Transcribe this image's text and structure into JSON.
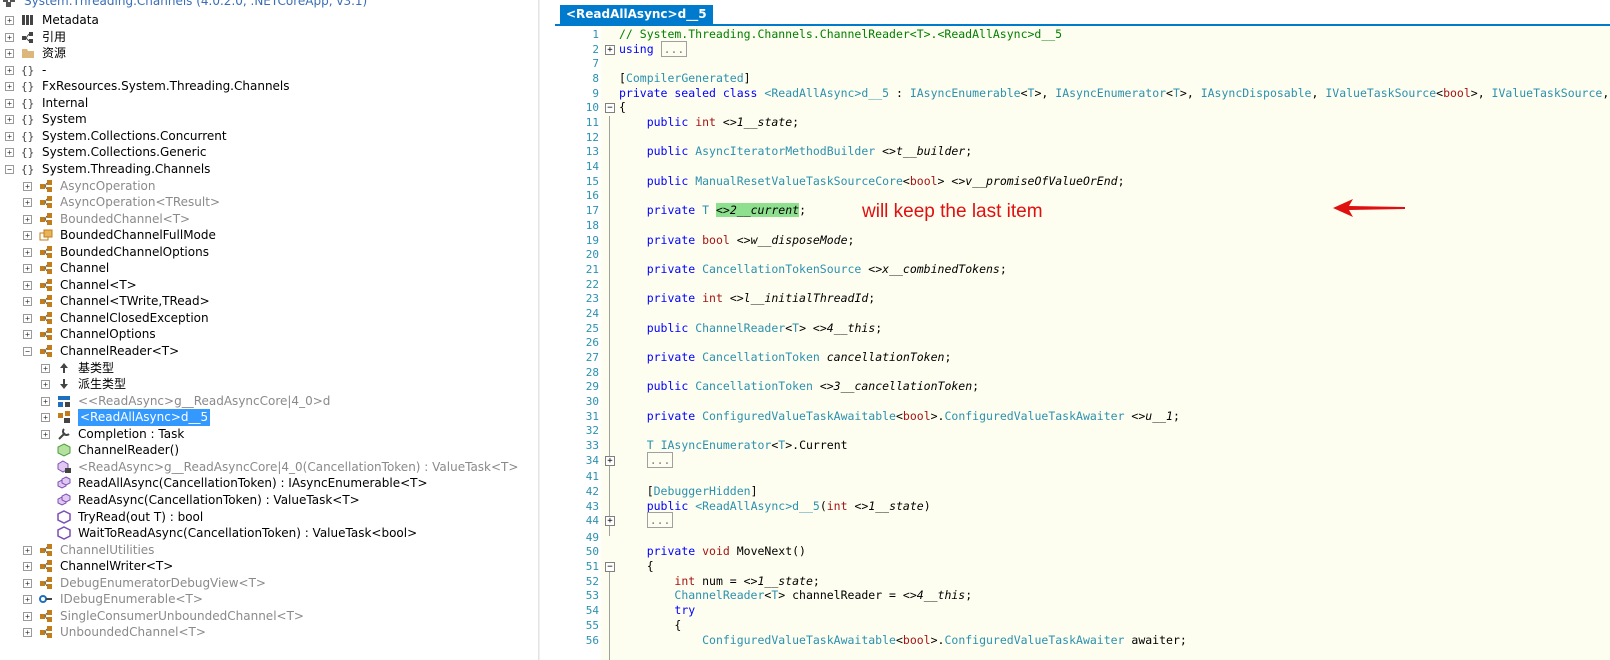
{
  "tree": {
    "root": "System.Threading.Channels (4.0.2.0, .NETCoreApp, v3.1)",
    "items": [
      {
        "label": "Metadata",
        "icon": "metadata-icon",
        "expander": "+",
        "indent": 0,
        "color": "black"
      },
      {
        "label": "引用",
        "icon": "references-icon",
        "expander": "+",
        "indent": 0,
        "color": "black"
      },
      {
        "label": "资源",
        "icon": "folder-icon",
        "expander": "+",
        "indent": 0,
        "color": "black"
      },
      {
        "label": "-",
        "icon": "namespace-icon",
        "expander": "+",
        "indent": 0,
        "color": "black"
      },
      {
        "label": "FxResources.System.Threading.Channels",
        "icon": "namespace-icon",
        "expander": "+",
        "indent": 0,
        "color": "black"
      },
      {
        "label": "Internal",
        "icon": "namespace-icon",
        "expander": "+",
        "indent": 0,
        "color": "black"
      },
      {
        "label": "System",
        "icon": "namespace-icon",
        "expander": "+",
        "indent": 0,
        "color": "black"
      },
      {
        "label": "System.Collections.Concurrent",
        "icon": "namespace-icon",
        "expander": "+",
        "indent": 0,
        "color": "black"
      },
      {
        "label": "System.Collections.Generic",
        "icon": "namespace-icon",
        "expander": "+",
        "indent": 0,
        "color": "black"
      },
      {
        "label": "System.Threading.Channels",
        "icon": "namespace-icon",
        "expander": "−",
        "indent": 0,
        "color": "black"
      },
      {
        "label": "AsyncOperation",
        "icon": "class-icon",
        "expander": "+",
        "indent": 1,
        "color": "gray"
      },
      {
        "label": "AsyncOperation<TResult>",
        "icon": "class-icon",
        "expander": "+",
        "indent": 1,
        "color": "gray"
      },
      {
        "label": "BoundedChannel<T>",
        "icon": "class-icon",
        "expander": "+",
        "indent": 1,
        "color": "gray"
      },
      {
        "label": "BoundedChannelFullMode",
        "icon": "enum-icon",
        "expander": "+",
        "indent": 1,
        "color": "black"
      },
      {
        "label": "BoundedChannelOptions",
        "icon": "class-icon",
        "expander": "+",
        "indent": 1,
        "color": "black"
      },
      {
        "label": "Channel",
        "icon": "class-icon",
        "expander": "+",
        "indent": 1,
        "color": "black"
      },
      {
        "label": "Channel<T>",
        "icon": "class-icon",
        "expander": "+",
        "indent": 1,
        "color": "black"
      },
      {
        "label": "Channel<TWrite,TRead>",
        "icon": "class-icon",
        "expander": "+",
        "indent": 1,
        "color": "black"
      },
      {
        "label": "ChannelClosedException",
        "icon": "class-icon",
        "expander": "+",
        "indent": 1,
        "color": "black"
      },
      {
        "label": "ChannelOptions",
        "icon": "class-icon",
        "expander": "+",
        "indent": 1,
        "color": "black"
      },
      {
        "label": "ChannelReader<T>",
        "icon": "class-icon",
        "expander": "−",
        "indent": 1,
        "color": "black"
      },
      {
        "label": "基类型",
        "icon": "base-types-icon",
        "expander": "+",
        "indent": 2,
        "color": "black"
      },
      {
        "label": "派生类型",
        "icon": "derived-types-icon",
        "expander": "+",
        "indent": 2,
        "color": "black"
      },
      {
        "label": "<<ReadAsync>g__ReadAsyncCore|4_0>d",
        "icon": "struct-icon",
        "expander": "+",
        "indent": 2,
        "color": "gray"
      },
      {
        "label": "<ReadAllAsync>d__5",
        "icon": "private-class-icon",
        "expander": "+",
        "indent": 2,
        "color": "black",
        "selected": true
      },
      {
        "label": "Completion : Task",
        "icon": "property-icon",
        "expander": "+",
        "indent": 2,
        "color": "black"
      },
      {
        "label": "ChannelReader()",
        "icon": "method-icon",
        "expander": "",
        "indent": 2,
        "color": "black"
      },
      {
        "label": "<ReadAsync>g__ReadAsyncCore|4_0(CancellationToken) : ValueTask<T>",
        "icon": "private-method-icon",
        "expander": "",
        "indent": 2,
        "color": "gray"
      },
      {
        "label": "ReadAllAsync(CancellationToken) : IAsyncEnumerable<T>",
        "icon": "virtual-method-icon",
        "expander": "",
        "indent": 2,
        "color": "black"
      },
      {
        "label": "ReadAsync(CancellationToken) : ValueTask<T>",
        "icon": "virtual-method-icon",
        "expander": "",
        "indent": 2,
        "color": "black"
      },
      {
        "label": "TryRead(out T) : bool",
        "icon": "abstract-method-icon",
        "expander": "",
        "indent": 2,
        "color": "black"
      },
      {
        "label": "WaitToReadAsync(CancellationToken) : ValueTask<bool>",
        "icon": "abstract-method-icon",
        "expander": "",
        "indent": 2,
        "color": "black"
      },
      {
        "label": "ChannelUtilities",
        "icon": "class-icon",
        "expander": "+",
        "indent": 1,
        "color": "gray"
      },
      {
        "label": "ChannelWriter<T>",
        "icon": "class-icon",
        "expander": "+",
        "indent": 1,
        "color": "black"
      },
      {
        "label": "DebugEnumeratorDebugView<T>",
        "icon": "class-icon",
        "expander": "+",
        "indent": 1,
        "color": "gray"
      },
      {
        "label": "IDebugEnumerable<T>",
        "icon": "interface-icon",
        "expander": "+",
        "indent": 1,
        "color": "gray"
      },
      {
        "label": "SingleConsumerUnboundedChannel<T>",
        "icon": "class-icon",
        "expander": "+",
        "indent": 1,
        "color": "gray"
      },
      {
        "label": "UnboundedChannel<T>",
        "icon": "class-icon",
        "expander": "+",
        "indent": 1,
        "color": "gray"
      }
    ]
  },
  "editor": {
    "tab_label": "<ReadAllAsync>d__5",
    "annotation": "will keep the last item",
    "lines": [
      {
        "n": "1",
        "fold": "",
        "html": "<span class=\"cm\">// System.Threading.Channels.ChannelReader&lt;T&gt;.&lt;ReadAllAsync&gt;d__5</span>"
      },
      {
        "n": "2",
        "fold": "+",
        "html": "<span class=\"kw\">using</span> <span class=\"coll\">...</span>"
      },
      {
        "n": "7",
        "fold": "",
        "html": ""
      },
      {
        "n": "8",
        "fold": "",
        "html": "[<span class=\"attr\">CompilerGenerated</span>]"
      },
      {
        "n": "9",
        "fold": "",
        "html": "<span class=\"kwb\">private sealed class</span> <span class=\"ty\">&lt;ReadAllAsync&gt;d__5</span> : <span class=\"ty\">IAsyncEnumerable</span>&lt;<span class=\"ty\">T</span>&gt;, <span class=\"ty\">IAsyncEnumerator</span>&lt;<span class=\"ty\">T</span>&gt;, <span class=\"ty\">IAsyncDisposable</span>, <span class=\"ty\">IValueTaskSource</span>&lt;<span class=\"sty\">bool</span>&gt;, <span class=\"ty\">IValueTaskSource</span>, <span class=\"ty\">IAsyncStateMachine</span>"
      },
      {
        "n": "10",
        "fold": "−",
        "html": "{"
      },
      {
        "n": "11",
        "fold": "",
        "html": "    <span class=\"kwb\">public</span> <span class=\"sty\">int</span> &lt;&gt;<span class=\"fld\">1__state</span>;"
      },
      {
        "n": "12",
        "fold": "",
        "html": ""
      },
      {
        "n": "13",
        "fold": "",
        "html": "    <span class=\"kwb\">public</span> <span class=\"ty\">AsyncIteratorMethodBuilder</span> &lt;&gt;<span class=\"fld\">t__builder</span>;"
      },
      {
        "n": "14",
        "fold": "",
        "html": ""
      },
      {
        "n": "15",
        "fold": "",
        "html": "    <span class=\"kwb\">public</span> <span class=\"ty\">ManualResetValueTaskSourceCore</span>&lt;<span class=\"sty\">bool</span>&gt; &lt;&gt;<span class=\"fld\">v__promiseOfValueOrEnd</span>;"
      },
      {
        "n": "16",
        "fold": "",
        "html": ""
      },
      {
        "n": "17",
        "fold": "",
        "html": "    <span class=\"kwb\">private</span> <span class=\"ty\">T</span> <span class=\"hl\">&lt;&gt;<span class=\"fld\">2__current</span></span>;"
      },
      {
        "n": "18",
        "fold": "",
        "html": ""
      },
      {
        "n": "19",
        "fold": "",
        "html": "    <span class=\"kwb\">private</span> <span class=\"sty\">bool</span> &lt;&gt;<span class=\"fld\">w__disposeMode</span>;"
      },
      {
        "n": "20",
        "fold": "",
        "html": ""
      },
      {
        "n": "21",
        "fold": "",
        "html": "    <span class=\"kwb\">private</span> <span class=\"ty\">CancellationTokenSource</span> &lt;&gt;<span class=\"fld\">x__combinedTokens</span>;"
      },
      {
        "n": "22",
        "fold": "",
        "html": ""
      },
      {
        "n": "23",
        "fold": "",
        "html": "    <span class=\"kwb\">private</span> <span class=\"sty\">int</span> &lt;&gt;<span class=\"fld\">l__initialThreadId</span>;"
      },
      {
        "n": "24",
        "fold": "",
        "html": ""
      },
      {
        "n": "25",
        "fold": "",
        "html": "    <span class=\"kwb\">public</span> <span class=\"ty\">ChannelReader</span>&lt;<span class=\"ty\">T</span>&gt; &lt;&gt;<span class=\"fld\">4__this</span>;"
      },
      {
        "n": "26",
        "fold": "",
        "html": ""
      },
      {
        "n": "27",
        "fold": "",
        "html": "    <span class=\"kwb\">private</span> <span class=\"ty\">CancellationToken</span> <span class=\"fld\">cancellationToken</span>;"
      },
      {
        "n": "28",
        "fold": "",
        "html": ""
      },
      {
        "n": "29",
        "fold": "",
        "html": "    <span class=\"kwb\">public</span> <span class=\"ty\">CancellationToken</span> &lt;&gt;<span class=\"fld\">3__cancellationToken</span>;"
      },
      {
        "n": "30",
        "fold": "",
        "html": ""
      },
      {
        "n": "31",
        "fold": "",
        "html": "    <span class=\"kwb\">private</span> <span class=\"ty\">ConfiguredValueTaskAwaitable</span>&lt;<span class=\"sty\">bool</span>&gt;.<span class=\"ty\">ConfiguredValueTaskAwaiter</span> &lt;&gt;<span class=\"fld\">u__1</span>;"
      },
      {
        "n": "32",
        "fold": "",
        "html": ""
      },
      {
        "n": "33",
        "fold": "",
        "html": "    <span class=\"ty\">T</span> <span class=\"ty\">IAsyncEnumerator</span>&lt;<span class=\"ty\">T</span>&gt;.Current"
      },
      {
        "n": "34",
        "fold": "+",
        "html": "    <span class=\"coll\">...</span>"
      },
      {
        "n": "41",
        "fold": "",
        "html": ""
      },
      {
        "n": "42",
        "fold": "",
        "html": "    [<span class=\"attr\">DebuggerHidden</span>]"
      },
      {
        "n": "43",
        "fold": "",
        "html": "    <span class=\"kwb\">public</span> <span class=\"ty\">&lt;ReadAllAsync&gt;d__5</span>(<span class=\"sty\">int</span> &lt;&gt;<span class=\"fld\">1__state</span>)"
      },
      {
        "n": "44",
        "fold": "+",
        "html": "    <span class=\"coll\">...</span>"
      },
      {
        "n": "49",
        "fold": "",
        "html": ""
      },
      {
        "n": "50",
        "fold": "",
        "html": "    <span class=\"kwb\">private</span> <span class=\"sty\">void</span> MoveNext()"
      },
      {
        "n": "51",
        "fold": "−",
        "html": "    {"
      },
      {
        "n": "52",
        "fold": "",
        "html": "        <span class=\"sty\">int</span> num = &lt;&gt;<span class=\"fld\">1__state</span>;"
      },
      {
        "n": "53",
        "fold": "",
        "html": "        <span class=\"ty\">ChannelReader</span>&lt;<span class=\"ty\">T</span>&gt; channelReader = &lt;&gt;<span class=\"fld\">4__this</span>;"
      },
      {
        "n": "54",
        "fold": "",
        "html": "        <span class=\"kw\">try</span>"
      },
      {
        "n": "55",
        "fold": "",
        "html": "        {"
      },
      {
        "n": "56",
        "fold": "",
        "html": "            <span class=\"ty\">ConfiguredValueTaskAwaitable</span>&lt;<span class=\"sty\">bool</span>&gt;.<span class=\"ty\">ConfiguredValueTaskAwaiter</span> awaiter;"
      }
    ]
  }
}
